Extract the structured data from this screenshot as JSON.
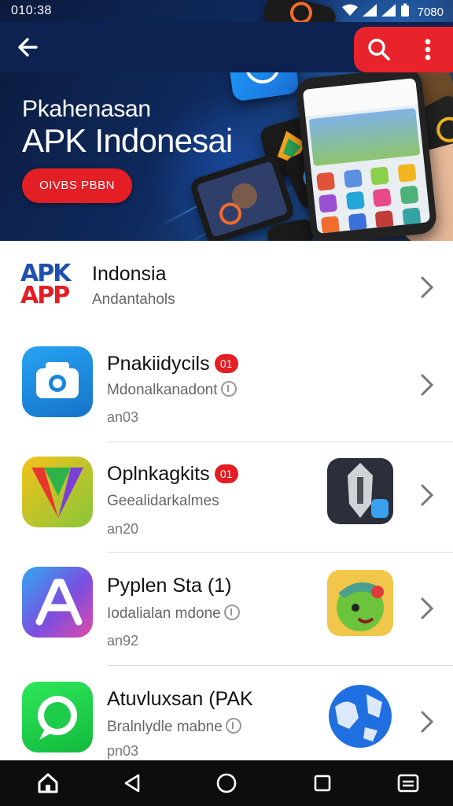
{
  "status": {
    "time": "010:38",
    "right_time": "7080"
  },
  "header": {
    "hero_title": "Pkahenasan",
    "hero_headline": "APK Indonesai",
    "cta_label": "OIVBS PBBN"
  },
  "featured": {
    "logo_line1": "APK",
    "logo_line2": "APP",
    "title": "Indonsia",
    "subtitle": "Andantahols"
  },
  "apps": [
    {
      "title": "Pnakiidycils",
      "badge": "01",
      "subtitle": "Mdonalkanadont",
      "meta": "an03",
      "icon": "camera-app-icon"
    },
    {
      "title": "Oplnkagkits",
      "badge": "01",
      "subtitle": "Geealidarkalmes",
      "meta": "an20",
      "icon": "triangles-app-icon",
      "thumb": "knight-helmet-thumbnail"
    },
    {
      "title": "Pyplen Sta (1)",
      "subtitle": "Iodalialan mdone",
      "meta": "an92",
      "icon": "letter-a-app-icon",
      "thumb": "green-monster-thumbnail"
    },
    {
      "title": "Atuvluxsan (PAK",
      "subtitle": "Bralnlydle mabne",
      "meta": "pn03",
      "icon": "chat-bubble-app-icon",
      "thumb": "globe-map-thumbnail"
    }
  ],
  "colors": {
    "accent_red": "#e31e24",
    "header_navy": "#0d2250",
    "nav_bar": "#0d0d0d"
  },
  "navbar": {
    "icons": [
      "home-icon",
      "back-triangle-icon",
      "home-circle-icon",
      "recents-square-icon",
      "menu-icon"
    ]
  }
}
